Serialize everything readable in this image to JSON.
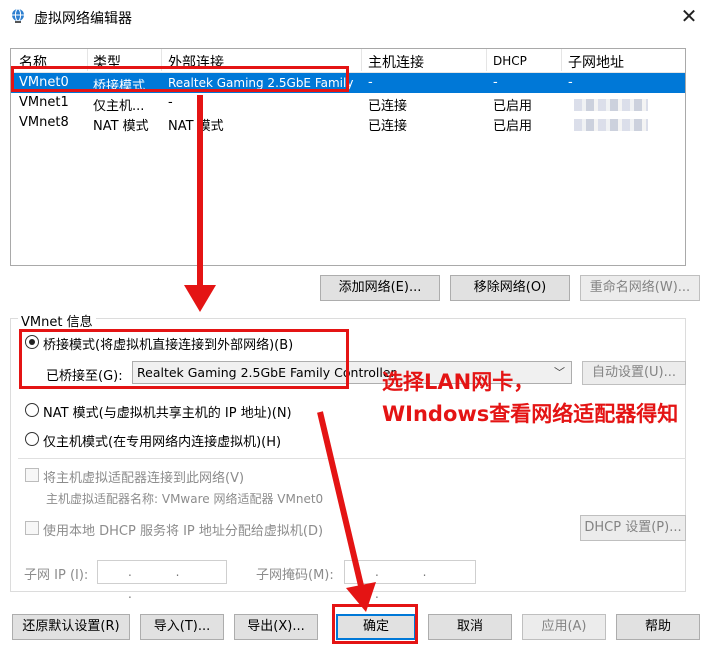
{
  "window": {
    "title": "虚拟网络编辑器"
  },
  "network_table": {
    "columns": [
      "名称",
      "类型",
      "外部连接",
      "主机连接",
      "DHCP",
      "子网地址"
    ],
    "rows": [
      {
        "name": "VMnet0",
        "type": "桥接模式",
        "external": "Realtek Gaming 2.5GbE Family ...",
        "host": "-",
        "dhcp": "-",
        "subnet": "-",
        "selected": true
      },
      {
        "name": "VMnet1",
        "type": "仅主机...",
        "external": "-",
        "host": "已连接",
        "dhcp": "已启用",
        "subnet": "",
        "selected": false
      },
      {
        "name": "VMnet8",
        "type": "NAT 模式",
        "external": "NAT 模式",
        "host": "已连接",
        "dhcp": "已启用",
        "subnet": "",
        "selected": false
      }
    ]
  },
  "table_buttons": {
    "add": "添加网络(E)...",
    "remove": "移除网络(O)",
    "rename": "重命名网络(W)..."
  },
  "vmnet_info": {
    "group_title": "VMnet 信息",
    "bridged_label": "桥接模式(将虚拟机直接连接到外部网络)(B)",
    "bridged_to_label": "已桥接至(G):",
    "bridged_to_value": "Realtek Gaming 2.5GbE Family Controller",
    "auto_settings": "自动设置(U)...",
    "nat_label": "NAT 模式(与虚拟机共享主机的 IP 地址)(N)",
    "hostonly_label": "仅主机模式(在专用网络内连接虚拟机)(H)",
    "connect_adapter_label": "将主机虚拟适配器连接到此网络(V)",
    "adapter_name_label": "主机虚拟适配器名称: VMware 网络适配器 VMnet0",
    "dhcp_label": "使用本地 DHCP 服务将 IP 地址分配给虚拟机(D)",
    "dhcp_settings": "DHCP 设置(P)...",
    "subnet_ip_label": "子网 IP (I):",
    "subnet_mask_label": "子网掩码(M):",
    "ip_placeholder": ".   .   ."
  },
  "footer_buttons": {
    "restore": "还原默认设置(R)",
    "import": "导入(T)...",
    "export": "导出(X)...",
    "ok": "确定",
    "cancel": "取消",
    "apply": "应用(A)",
    "help": "帮助"
  },
  "annotation": {
    "line1": "选择LAN网卡，",
    "line2": "WIndows查看网络适配器得知"
  },
  "colors": {
    "accent": "#0078d7",
    "annotation": "#e41414"
  }
}
